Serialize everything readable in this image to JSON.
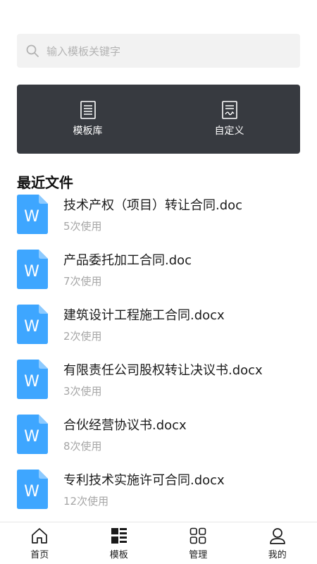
{
  "search": {
    "placeholder": "输入模板关键字"
  },
  "banner": {
    "buttons": [
      {
        "label": "模板库",
        "icon": "template-library-icon"
      },
      {
        "label": "自定义",
        "icon": "custom-document-icon"
      }
    ]
  },
  "recent": {
    "title": "最近文件",
    "items": [
      {
        "name": "技术产权（项目）转让合同.doc",
        "usage": "5次使用"
      },
      {
        "name": "产品委托加工合同.doc",
        "usage": "7次使用"
      },
      {
        "name": "建筑设计工程施工合同.docx",
        "usage": "2次使用"
      },
      {
        "name": "有限责任公司股权转让决议书.docx",
        "usage": "3次使用"
      },
      {
        "name": "合伙经营协议书.docx",
        "usage": "8次使用"
      },
      {
        "name": "专利技术实施许可合同.docx",
        "usage": "12次使用"
      }
    ],
    "file_icon_letter": "W",
    "file_icon_color": "#3ea6ff"
  },
  "tabbar": {
    "tabs": [
      {
        "label": "首页",
        "icon": "home-icon"
      },
      {
        "label": "模板",
        "icon": "template-icon",
        "active": true
      },
      {
        "label": "管理",
        "icon": "grid-manage-icon"
      },
      {
        "label": "我的",
        "icon": "user-icon"
      }
    ]
  }
}
